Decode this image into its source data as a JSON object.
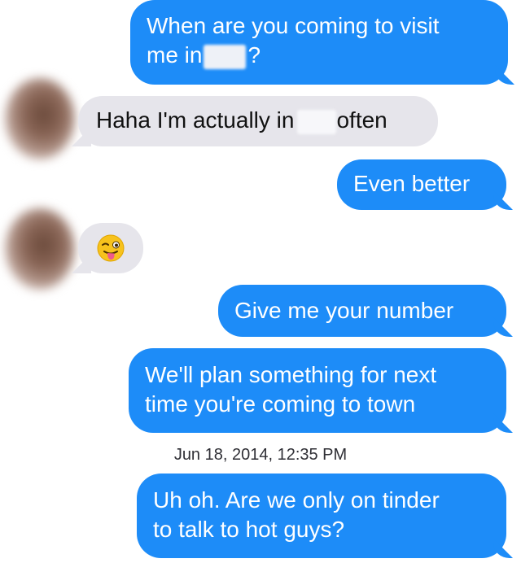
{
  "messages": [
    {
      "id": "m1",
      "direction": "outgoing",
      "line1": "When are you coming to visit",
      "line2_before": "me in",
      "line2_after": "?"
    },
    {
      "id": "m2",
      "direction": "incoming",
      "before": "Haha I'm actually in",
      "after": "often"
    },
    {
      "id": "m3",
      "direction": "outgoing",
      "text": "Even better"
    },
    {
      "id": "m4",
      "direction": "incoming",
      "emoji": "winking-face-with-tongue"
    },
    {
      "id": "m5",
      "direction": "outgoing",
      "text": "Give me your number"
    },
    {
      "id": "m6",
      "direction": "outgoing",
      "line1": "We'll plan something for next",
      "line2": "time you're coming to town"
    },
    {
      "id": "m7",
      "direction": "outgoing",
      "line1": "Uh oh. Are we only on tinder",
      "line2": "to talk to hot guys?"
    }
  ],
  "timestamp": "Jun 18, 2014, 12:35 PM",
  "colors": {
    "outgoing_bubble": "#1d8cf8",
    "incoming_bubble": "#e6e5eb",
    "outgoing_text": "#ffffff",
    "incoming_text": "#111111"
  }
}
